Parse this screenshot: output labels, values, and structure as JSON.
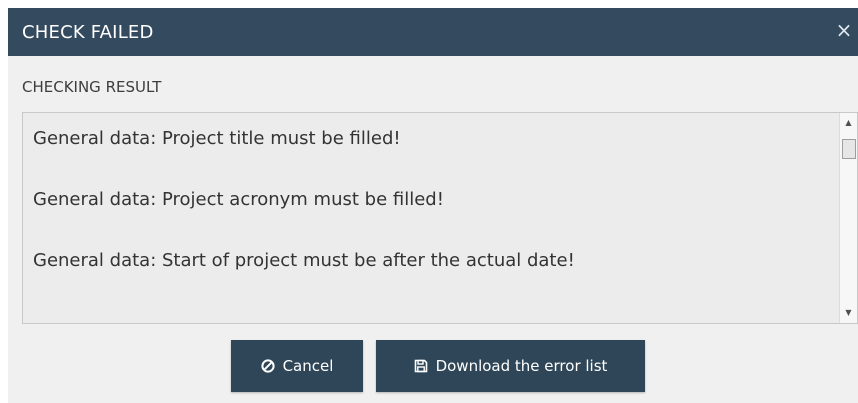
{
  "dialog": {
    "title": "CHECK FAILED",
    "close_glyph": "×",
    "section_label": "CHECKING RESULT",
    "results": [
      "General data: Project title must be filled!",
      "General data: Project acronym must be filled!",
      "General data: Start of project must be after the actual date!"
    ],
    "buttons": {
      "cancel_label": "Cancel",
      "cancel_icon": "cancel-circle-icon",
      "download_label": "Download the error list",
      "download_icon": "floppy-disk-icon"
    }
  },
  "colors": {
    "titlebar": "#344a5e",
    "button": "#2f4658",
    "panel_bg": "#f0f0f0",
    "result_bg": "#ececec"
  }
}
